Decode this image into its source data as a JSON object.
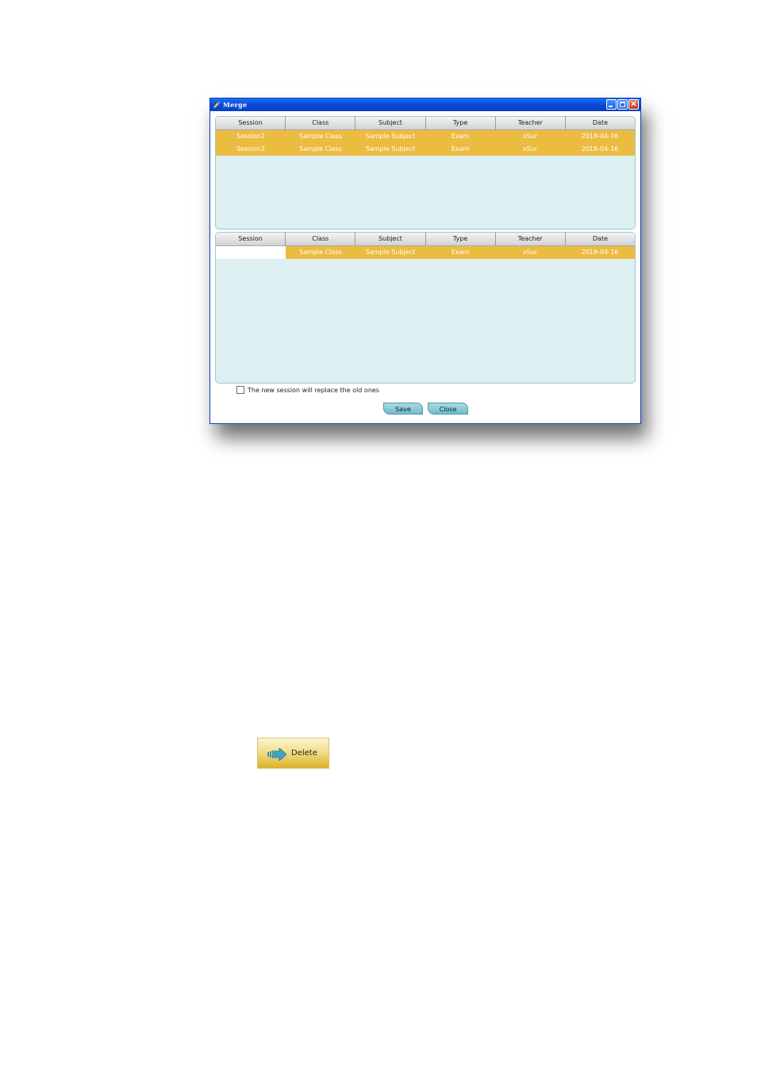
{
  "window": {
    "title": "Merge",
    "icon": "merge-app-icon"
  },
  "top_grid": {
    "columns": [
      "Session",
      "Class",
      "Subject",
      "Type",
      "Teacher",
      "Date"
    ],
    "rows": [
      [
        "Session2",
        "Sample Class",
        "Sample Subject",
        "Exam",
        "xSur",
        "2018-04-16"
      ],
      [
        "Session3",
        "Sample Class",
        "Sample Subject",
        "Exam",
        "xSur",
        "2018-04-16"
      ]
    ]
  },
  "bottom_grid": {
    "columns": [
      "Session",
      "Class",
      "Subject",
      "Type",
      "Teacher",
      "Date"
    ],
    "rows": [
      [
        "",
        "Sample Class",
        "Sample Subject",
        "Exam",
        "xSur",
        "2018-04-16"
      ]
    ]
  },
  "replace_option": {
    "label": "The new session will replace the old ones",
    "checked": false
  },
  "buttons": {
    "save": "Save",
    "close": "Close"
  },
  "delete_button": {
    "label": "Delete",
    "icon": "arrow-right-icon"
  },
  "colors": {
    "selected_row": "#ecbc40",
    "grid_bg": "#deeff1",
    "titlebar": "#0648d6",
    "button": "#8fcbd6"
  }
}
